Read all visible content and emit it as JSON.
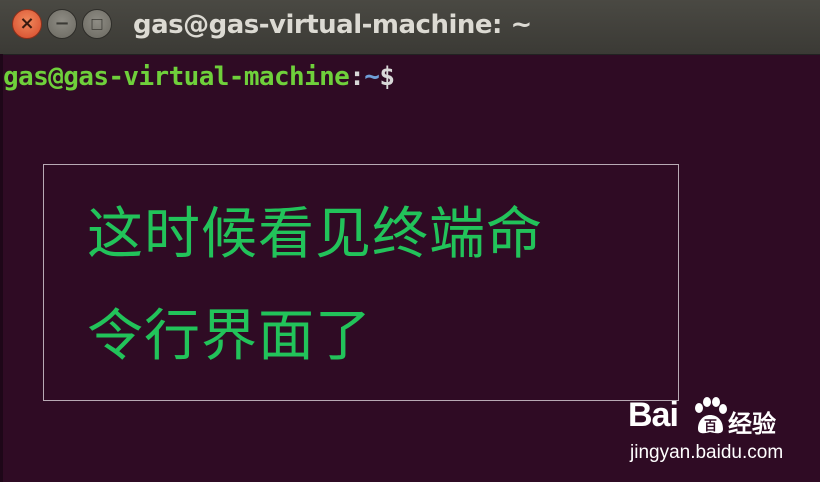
{
  "window": {
    "title": "gas@gas-virtual-machine: ~",
    "buttons": {
      "close_glyph": "×",
      "minimize_glyph": "−",
      "maximize_glyph": "□"
    }
  },
  "terminal": {
    "prompt_user_host": "gas@gas-virtual-machine",
    "prompt_colon": ":",
    "prompt_path": "~",
    "prompt_symbol": "$"
  },
  "caption": {
    "line1": "这时候看见终端命",
    "line2": "令行界面了"
  },
  "watermark": {
    "logo_text": "Bai",
    "logo_text_after_paw": "百",
    "jingyan": "经验",
    "url": "jingyan.baidu.com"
  },
  "colors": {
    "background": "#2f0b24",
    "titlebar": "#3b3a35",
    "prompt_user": "#6fd03b",
    "prompt_path": "#6f9fd8",
    "caption_text": "#22c35a",
    "close_button": "#e0552f"
  }
}
